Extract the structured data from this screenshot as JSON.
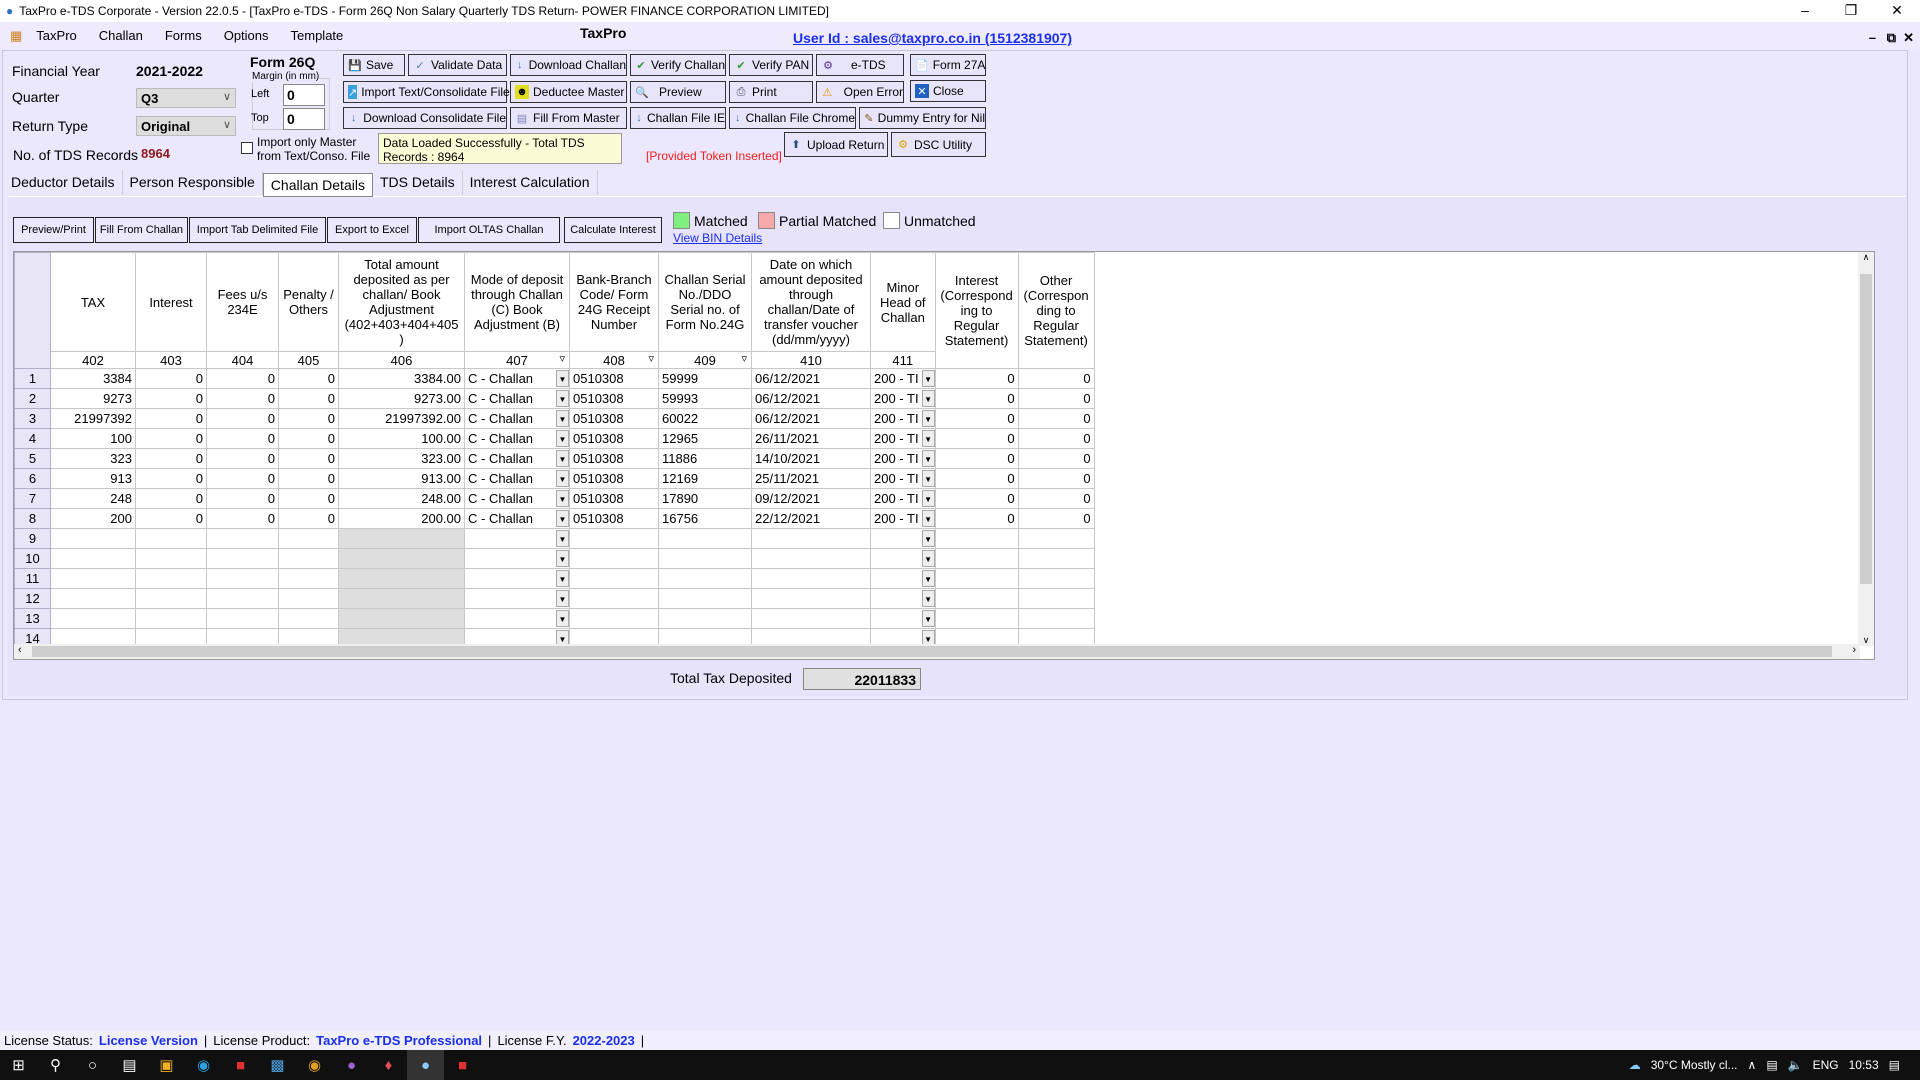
{
  "window": {
    "title": "TaxPro e-TDS Corporate - Version 22.0.5 - [TaxPro e-TDS - Form 26Q Non Salary Quarterly TDS Return- POWER FINANCE CORPORATION LIMITED]",
    "app_title": "TaxPro",
    "user_id": "User Id : sales@taxpro.co.in (1512381907)"
  },
  "menu": [
    "TaxPro",
    "Challan",
    "Forms",
    "Options",
    "Template"
  ],
  "form": {
    "fy_label": "Financial Year",
    "fy_value": "2021-2022",
    "quarter_label": "Quarter",
    "quarter_value": "Q3",
    "return_type_label": "Return Type",
    "return_type_value": "Original",
    "records_label": "No. of TDS Records",
    "records_value": "8964",
    "form_name": "Form 26Q",
    "margin_label": "Margin (in mm)",
    "left_label": "Left",
    "left_value": "0",
    "top_label": "Top",
    "top_value": "0",
    "import_master_label": "Import only Master from Text/Conso. File",
    "import_master_checked": false,
    "message": "Data Loaded Successfully - Total TDS Records : 8964",
    "token": "[Provided Token Inserted]"
  },
  "buttons": {
    "save": "Save",
    "validate": "Validate Data",
    "download_challan": "Download Challan",
    "verify_challan": "Verify Challan",
    "verify_pan": "Verify PAN",
    "etds": "e-TDS",
    "form27a": "Form 27A",
    "import_text": "Import Text/Consolidate File",
    "deductee_master": "Deductee Master",
    "preview": "Preview",
    "print": "Print",
    "open_error": "Open Error",
    "close": "Close",
    "download_consolidate": "Download Consolidate File",
    "fill_master": "Fill From Master",
    "challan_ie": "Challan File IE",
    "challan_chrome": "Challan File Chrome",
    "dummy_nil": "Dummy Entry for Nil",
    "upload": "Upload Return",
    "dsc": "DSC Utility"
  },
  "tabs": [
    {
      "label": "Deductor Details"
    },
    {
      "label": "Person Responsible"
    },
    {
      "label": "Challan Details",
      "active": true
    },
    {
      "label": "TDS Details"
    },
    {
      "label": "Interest Calculation"
    }
  ],
  "toolbar": [
    "Preview/Print",
    "Fill From Challan",
    "Import Tab Delimited File",
    "Export to Excel",
    "Import OLTAS Challan",
    "Calculate Interest"
  ],
  "legend": {
    "matched": "Matched",
    "partial": "Partial Matched",
    "unmatched": "Unmatched",
    "colors": {
      "matched": "#7ff07f",
      "partial": "#f7a8a8",
      "unmatched": "#ffffff"
    },
    "bin_link": "View BIN Details"
  },
  "grid": {
    "headers": [
      "TAX",
      "Interest",
      "Fees u/s 234E",
      "Penalty / Others",
      "Total amount deposited as per challan/ Book Adjustment (402+403+404+405 )",
      "Mode of deposit through Challan (C) Book Adjustment (B)",
      "Bank-Branch Code/ Form 24G Receipt Number",
      "Challan Serial No./DDO Serial no. of Form No.24G",
      "Date on which amount deposited through challan/Date of transfer voucher (dd/mm/yyyy)",
      "Minor Head of Challan",
      "Interest (Correspond ing to Regular Statement)",
      "Other (Correspon ding to Regular Statement)"
    ],
    "codes": [
      "402",
      "403",
      "404",
      "405",
      "406",
      "407",
      "408",
      "409",
      "410",
      "411",
      "",
      ""
    ],
    "rows": [
      [
        "3384",
        "0",
        "0",
        "0",
        "3384.00",
        "C - Challan",
        "0510308",
        "59999",
        "06/12/2021",
        "200 - TI",
        "0",
        "0"
      ],
      [
        "9273",
        "0",
        "0",
        "0",
        "9273.00",
        "C - Challan",
        "0510308",
        "59993",
        "06/12/2021",
        "200 - TI",
        "0",
        "0"
      ],
      [
        "21997392",
        "0",
        "0",
        "0",
        "21997392.00",
        "C - Challan",
        "0510308",
        "60022",
        "06/12/2021",
        "200 - TI",
        "0",
        "0"
      ],
      [
        "100",
        "0",
        "0",
        "0",
        "100.00",
        "C - Challan",
        "0510308",
        "12965",
        "26/11/2021",
        "200 - TI",
        "0",
        "0"
      ],
      [
        "323",
        "0",
        "0",
        "0",
        "323.00",
        "C - Challan",
        "0510308",
        "11886",
        "14/10/2021",
        "200 - TI",
        "0",
        "0"
      ],
      [
        "913",
        "0",
        "0",
        "0",
        "913.00",
        "C - Challan",
        "0510308",
        "12169",
        "25/11/2021",
        "200 - TI",
        "0",
        "0"
      ],
      [
        "248",
        "0",
        "0",
        "0",
        "248.00",
        "C - Challan",
        "0510308",
        "17890",
        "09/12/2021",
        "200 - TI",
        "0",
        "0"
      ],
      [
        "200",
        "0",
        "0",
        "0",
        "200.00",
        "C - Challan",
        "0510308",
        "16756",
        "22/12/2021",
        "200 - TI",
        "0",
        "0"
      ]
    ],
    "row_numbers": [
      "1",
      "2",
      "3",
      "4",
      "5",
      "6",
      "7",
      "8",
      "9",
      "10",
      "11",
      "12",
      "13",
      "14"
    ]
  },
  "total": {
    "label": "Total Tax Deposited",
    "value": "22011833"
  },
  "status": {
    "license_status_label": "License Status:",
    "license_status": "License Version",
    "product_label": "License Product:",
    "product": "TaxPro e-TDS Professional",
    "fy_label": "License F.Y.",
    "fy": "2022-2023"
  },
  "taskbar": {
    "weather": "30°C  Mostly cl...",
    "lang": "ENG",
    "time": "10:53"
  }
}
